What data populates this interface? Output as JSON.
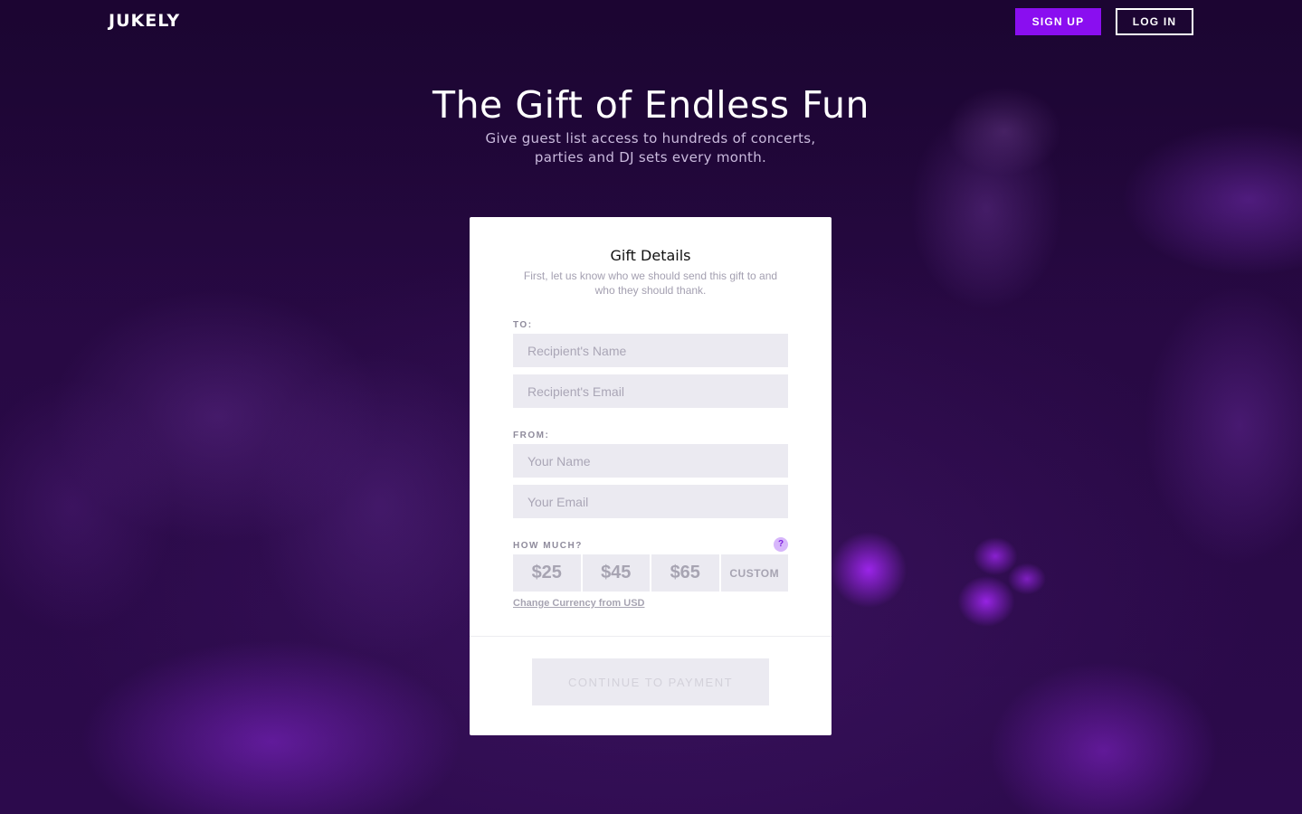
{
  "header": {
    "logo": "JUKELY",
    "signup_label": "SIGN UP",
    "login_label": "LOG IN"
  },
  "hero": {
    "title": "The Gift of Endless Fun",
    "subtitle_line1": "Give guest list access to hundreds of concerts,",
    "subtitle_line2": "parties and DJ sets every month."
  },
  "form": {
    "title": "Gift Details",
    "description_line1": "First, let us know who we should send this gift to and",
    "description_line2": "who they should thank.",
    "to_label": "TO:",
    "recipient_name_placeholder": "Recipient's Name",
    "recipient_email_placeholder": "Recipient's Email",
    "from_label": "FROM:",
    "your_name_placeholder": "Your Name",
    "your_email_placeholder": "Your Email",
    "amount_label": "HOW MUCH?",
    "help_icon": "?",
    "amounts": [
      "$25",
      "$45",
      "$65",
      "CUSTOM"
    ],
    "currency_link": "Change Currency from USD",
    "continue_label": "CONTINUE TO PAYMENT"
  },
  "colors": {
    "accent": "#8a0ef0",
    "background": "#26073f",
    "field": "#ebeaf1"
  }
}
